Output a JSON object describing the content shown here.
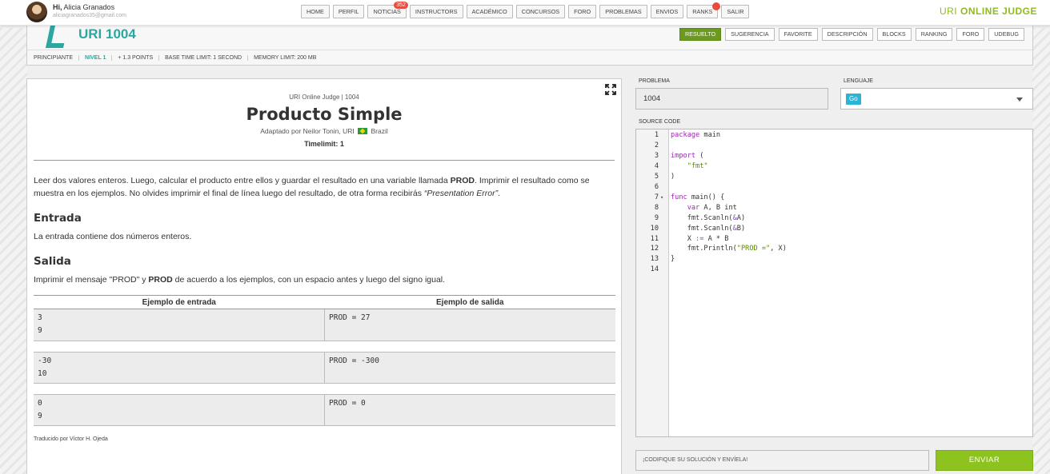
{
  "user": {
    "hi": "Hi,",
    "name": "Alicia Granados",
    "email": "aliciagranados35@gmail.com"
  },
  "nav": [
    {
      "label": "HOME"
    },
    {
      "label": "PERFIL"
    },
    {
      "label": "NOTICIAS",
      "badge": "352"
    },
    {
      "label": "INSTRUCTORS"
    },
    {
      "label": "ACADÉMICO"
    },
    {
      "label": "CONCURSOS"
    },
    {
      "label": "FORO"
    },
    {
      "label": "PROBLEMAS"
    },
    {
      "label": "ENVIOS"
    },
    {
      "label": "RANKS"
    },
    {
      "label": "SALIR"
    }
  ],
  "brand": {
    "part1": "URI",
    "part2": "ONLINE JUDGE"
  },
  "problem_header": {
    "title": "URI 1004",
    "tabs": [
      "RESUELTO",
      "SUGERENCIA",
      "FAVORITE",
      "DESCRIPCIÓN",
      "BLOCKS",
      "RANKING",
      "FORO",
      "UDEBUG"
    ],
    "meta": [
      "PRINCIPIANTE",
      "NIVEL 1",
      "+ 1.3 POINTS",
      "BASE TIME LIMIT: 1 SECOND",
      "MEMORY LIMIT: 200 MB"
    ]
  },
  "statement": {
    "source": "URI Online Judge | 1004",
    "title": "Producto Simple",
    "adapted_pre": "Adaptado por Neilor Tonin, URI",
    "adapted_country": "Brazil",
    "timelimit": "Timelimit: 1",
    "desc_1": "Leer dos valores enteros. Luego, calcular el producto entre ellos y guardar el resultado en una variable llamada ",
    "desc_bold": "PROD",
    "desc_2": ". Imprimir el resultado como se muestra en los ejemplos. No olvides imprimir el final de línea luego del resultado, de otra forma recibirás ",
    "desc_italic": "“Presentation Error”",
    "desc_3": ".",
    "input_heading": "Entrada",
    "input_text": "La entrada contiene dos números enteros.",
    "output_heading": "Salida",
    "output_pre": "Imprimir el mensaje \"PROD\" y ",
    "output_bold": "PROD",
    "output_post": " de acuerdo a los ejemplos, con un espacio antes y luego del signo igual.",
    "examples_input_header": "Ejemplo de entrada",
    "examples_output_header": "Ejemplo de salida",
    "examples": [
      {
        "input": "3\n9",
        "output": "PROD = 27"
      },
      {
        "input": "-30\n10",
        "output": "PROD = -300"
      },
      {
        "input": "0\n9",
        "output": "PROD = 0"
      }
    ],
    "translated": "Traducido por Víctor H. Ojeda"
  },
  "form": {
    "problem_label": "PROBLEMA",
    "problem_value": "1004",
    "language_label": "LENGUAJE",
    "language_value": "Go",
    "source_label": "SOURCE CODE",
    "submit_placeholder": "¡CODIFIQUE SU SOLUCIÓN Y ENVÍELA!",
    "send_label": "ENVIAR"
  },
  "code_lines": [
    {
      "n": "1",
      "text": "package main"
    },
    {
      "n": "2",
      "text": ""
    },
    {
      "n": "3",
      "text": "import ("
    },
    {
      "n": "4",
      "text": "    \"fmt\""
    },
    {
      "n": "5",
      "text": ")"
    },
    {
      "n": "6",
      "text": ""
    },
    {
      "n": "7",
      "text": "func main() {"
    },
    {
      "n": "8",
      "text": "    var A, B int"
    },
    {
      "n": "9",
      "text": "    fmt.Scanln(&A)"
    },
    {
      "n": "10",
      "text": "    fmt.Scanln(&B)"
    },
    {
      "n": "11",
      "text": "    X := A * B"
    },
    {
      "n": "12",
      "text": "    fmt.Println(\"PROD =\", X)"
    },
    {
      "n": "13",
      "text": "}"
    },
    {
      "n": "14",
      "text": ""
    }
  ],
  "colors": {
    "accent_green": "#8dc21f",
    "teal": "#2aa7a0",
    "badge_red": "#e84c3d",
    "go_chip": "#2ab5d6"
  }
}
